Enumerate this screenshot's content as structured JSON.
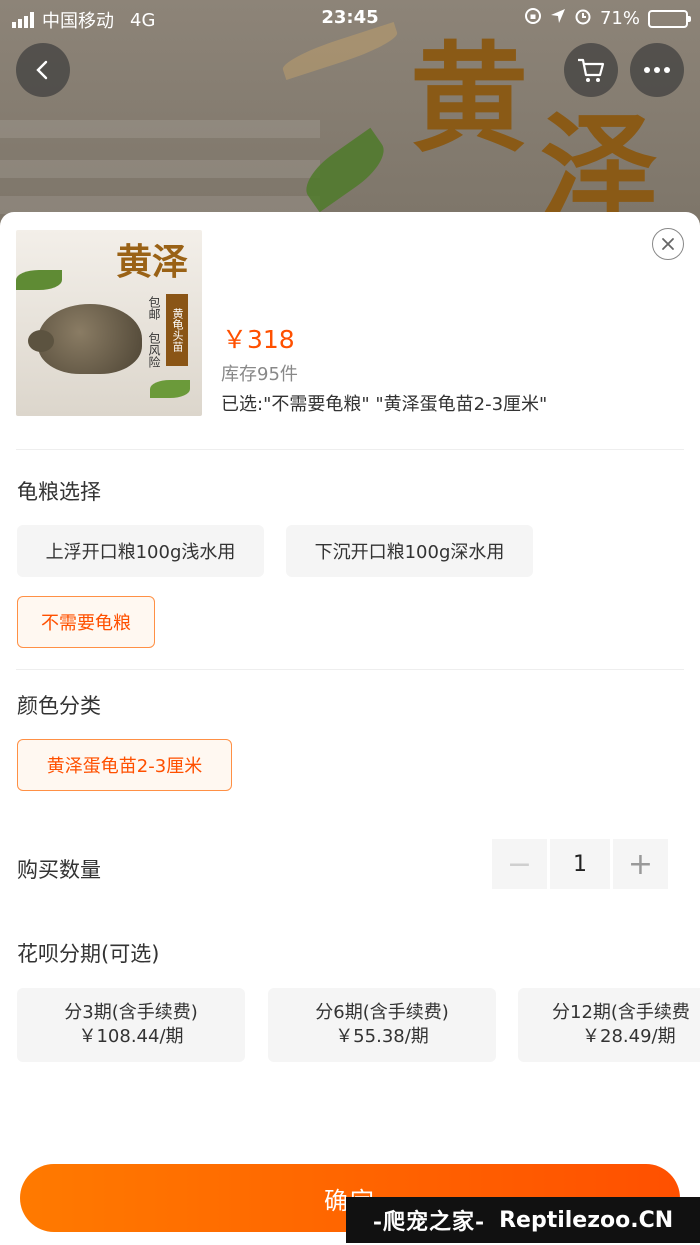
{
  "status_bar": {
    "carrier": "中国移动",
    "network": "4G",
    "time": "23:45",
    "battery": "71%",
    "battery_level": 0.71
  },
  "backdrop": {
    "hero_chars": [
      "黄",
      "泽"
    ]
  },
  "product": {
    "thumb_title": "黄泽",
    "thumb_badge": "黄龟头苗",
    "thumb_tags": [
      "包邮",
      "包风险"
    ],
    "price": "￥318",
    "stock": "库存95件",
    "selected": "已选:\"不需要龟粮\" \"黄泽蛋龟苗2-3厘米\""
  },
  "food": {
    "title": "龟粮选择",
    "options": [
      "上浮开口粮100g浅水用",
      "下沉开口粮100g深水用",
      "不需要龟粮"
    ],
    "selected_index": 2
  },
  "color": {
    "title": "颜色分类",
    "options": [
      "黄泽蛋龟苗2-3厘米"
    ],
    "selected_index": 0
  },
  "quantity": {
    "label": "购买数量",
    "value": "1",
    "minus": "−",
    "plus": "+"
  },
  "installments": {
    "title": "花呗分期(可选)",
    "plans": [
      {
        "label": "分3期(含手续费)",
        "amount": "￥108.44/期"
      },
      {
        "label": "分6期(含手续费)",
        "amount": "￥55.38/期"
      },
      {
        "label": "分12期(含手续费",
        "amount": "￥28.49/期"
      }
    ]
  },
  "confirm_label": "确定",
  "watermark": {
    "cn": "-爬宠之家-",
    "en": "Reptilezoo.CN"
  },
  "colors": {
    "accent": "#ff5000",
    "accent_gradient_start": "#ff7a00",
    "chip_bg": "#f5f5f5",
    "chip_active_border": "#ff9045"
  }
}
